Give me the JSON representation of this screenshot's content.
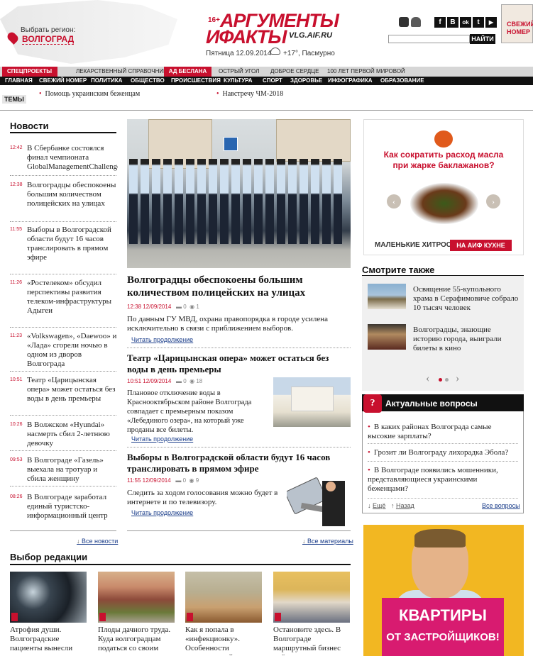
{
  "header": {
    "region_label": "Выбрать регион:",
    "region_name": "ВОЛГОГРАД",
    "logo_age": "16+",
    "logo_line1": "АРГУМЕНТЫ",
    "logo_line2": "ИФАКТЫ",
    "logo_domain": "VLG.AIF.RU",
    "date": "Пятница 12.09.2014",
    "weather": "+17°, Пасмурно",
    "search_button": "НАЙТИ",
    "fresh_issue": "СВЕЖИЙ НОМЕР",
    "social": [
      "f",
      "В",
      "ok",
      "t",
      "▶"
    ]
  },
  "nav_top": {
    "special": "СПЕЦПРОЕКТЫ",
    "items": [
      "ЛЕКАРСТВЕННЫЙ СПРАВОЧНИК",
      "АД БЕСЛАНА",
      "ОСТРЫЙ УГОЛ",
      "ДОБРОЕ СЕРДЦЕ",
      "100 ЛЕТ ПЕРВОЙ МИРОВОЙ"
    ]
  },
  "nav_main": [
    "ГЛАВНАЯ",
    "СВЕЖИЙ НОМЕР",
    "ПОЛИТИКА",
    "ОБЩЕСТВО",
    "ПРОИСШЕСТВИЯ",
    "КУЛЬТУРА",
    "СПОРТ",
    "ЗДОРОВЬЕ",
    "ИНФОГРАФИКА",
    "ОБРАЗОВАНИЕ"
  ],
  "themes": {
    "label": "ТЕМЫ",
    "items": [
      "Помощь украинским беженцам",
      "Навстречу ЧМ-2018"
    ]
  },
  "news": {
    "title": "Новости",
    "items": [
      {
        "time": "12:42",
        "text": "В Сбербанке состоялся финал чемпионата GlobalManagementChallenge"
      },
      {
        "time": "12:38",
        "text": "Волгоградцы обеспокоены большим количеством полицейских на улицах"
      },
      {
        "time": "11:55",
        "text": "Выборы в Волгоградской области будут 16 часов транслировать в прямом эфире"
      },
      {
        "time": "11:26",
        "text": "«Ростелеком» обсудил перспективы развития телеком-инфраструктуры Адыгеи"
      },
      {
        "time": "11:23",
        "text": "«Volkswagen», «Daewoo» и «Лада» сгорели ночью в одном из дворов Волгограда"
      },
      {
        "time": "10:51",
        "text": "Театр «Царицынская опера» может остаться без воды в день премьеры"
      },
      {
        "time": "10:26",
        "text": "В Волжском «Hyundai» насмерть сбил 2-летнюю девочку"
      },
      {
        "time": "09:53",
        "text": "В Волгограде «Газель» выехала на тротуар и сбила женщину"
      },
      {
        "time": "08:26",
        "text": "В Волгограде заработал единый туристско-информационный центр"
      }
    ],
    "all_link": "Все новости"
  },
  "articles": {
    "main": {
      "title": "Волгоградцы обеспокоены большим количеством полицейских на улицах",
      "time": "12:38 12/09/2014",
      "comments": "0",
      "views": "1",
      "text": "По данным ГУ МВД, охрана правопорядка в городе усилена исключительно в связи с приближением выборов.",
      "read_more": "Читать продолжение"
    },
    "second": {
      "title": "Театр «Царицынская опера» может остаться без воды в день премьеры",
      "time": "10:51 12/09/2014",
      "comments": "0",
      "views": "18",
      "text": "Плановое отключение воды в Краснооктябрьском районе Волгограда совпадает с премьерным показом «Лебединого озера», на который уже проданы все билеты.",
      "read_more": "Читать продолжение"
    },
    "third": {
      "title": "Выборы в Волгоградской области будут 16 часов транслировать в прямом эфире",
      "time": "11:55 12/09/2014",
      "comments": "0",
      "views": "9",
      "text": "Следить за ходом голосования можно будет в интернете и по телевизору.",
      "read_more": "Читать продолжение"
    },
    "all_link": "Все материалы"
  },
  "ad_kitchen": {
    "title": "Как сократить расход масла при жарке баклажанов?",
    "footer": "МАЛЕНЬКИЕ ХИТРОСТИ",
    "badge": "НА АИФ КУХНЕ"
  },
  "see_also": {
    "title": "Смотрите также",
    "items": [
      "Освящение 55-купольного храма в Серафимовиче собрало 10 тысяч человек",
      "Волгоградцы, знающие историю города, выиграли билеты в кино"
    ]
  },
  "questions": {
    "title": "Актуальные вопросы",
    "items": [
      "В каких районах Волгограда самые высокие зарплаты?",
      "Грозит ли Волгограду лихорадка Эбола?",
      "В Волгограде появились мошенники, представляющиеся украинскими беженцами?"
    ],
    "more": "Ещё",
    "back": "Назад",
    "all": "Все вопросы"
  },
  "ad_apartments": {
    "line1": "КВАРТИРЫ",
    "line2": "ОТ ЗАСТРОЙЩИКОВ!"
  },
  "editors_choice": {
    "title": "Выбор редакции",
    "items": [
      "Атрофия души. Волгоградские пациенты вынесли вердикт",
      "Плоды дачного труда. Куда волгоградцам податься со своим урожаем",
      "Как я попала в «инфекционку». Особенности волгоградской медицины",
      "Остановите здесь. В Волгограде маршрутный бизнес идёт на рекорды"
    ]
  },
  "colors": {
    "accent": "#c8102e",
    "nav_dark": "#111111",
    "link": "#1a3d8a"
  }
}
